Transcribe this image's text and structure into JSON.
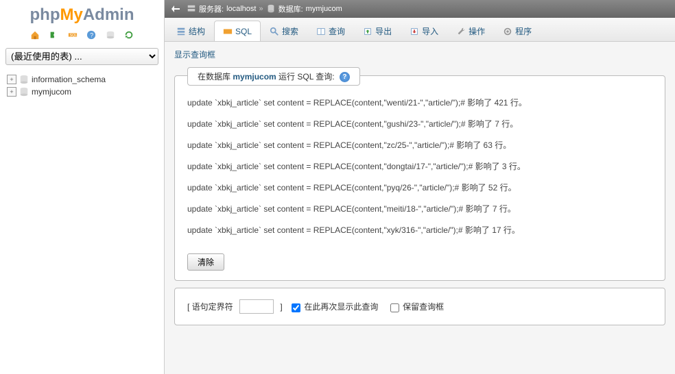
{
  "logo": {
    "part1": "php",
    "part2": "My",
    "part3": "Admin"
  },
  "recent_tables_label": "(最近使用的表) ...",
  "databases": [
    {
      "name": "information_schema"
    },
    {
      "name": "mymjucom"
    }
  ],
  "breadcrumb": {
    "server_label": "服务器:",
    "server_value": "localhost",
    "db_label": "数据库:",
    "db_value": "mymjucom"
  },
  "tabs": [
    {
      "id": "structure",
      "label": "结构"
    },
    {
      "id": "sql",
      "label": "SQL",
      "active": true
    },
    {
      "id": "search",
      "label": "搜索"
    },
    {
      "id": "query",
      "label": "查询"
    },
    {
      "id": "export",
      "label": "导出"
    },
    {
      "id": "import",
      "label": "导入"
    },
    {
      "id": "operations",
      "label": "操作"
    },
    {
      "id": "routines",
      "label": "程序"
    }
  ],
  "show_query_frame": "显示查询框",
  "panel_title_prefix": "在数据库 ",
  "panel_title_db": "mymjucom",
  "panel_title_suffix": " 运行 SQL 查询:",
  "sql_results": [
    "update `xbkj_article` set content = REPLACE(content,\"wenti/21-\",\"article/\");# 影响了 421 行。",
    "update `xbkj_article` set content = REPLACE(content,\"gushi/23-\",\"article/\");# 影响了 7 行。",
    "update `xbkj_article` set content = REPLACE(content,\"zc/25-\",\"article/\");# 影响了 63 行。",
    "update `xbkj_article` set content = REPLACE(content,\"dongtai/17-\",\"article/\");# 影响了 3 行。",
    "update `xbkj_article` set content = REPLACE(content,\"pyq/26-\",\"article/\");# 影响了 52 行。",
    "update `xbkj_article` set content = REPLACE(content,\"meiti/18-\",\"article/\");# 影响了 7 行。",
    "update `xbkj_article` set content = REPLACE(content,\"xyk/316-\",\"article/\");# 影响了 17 行。"
  ],
  "clear_label": "清除",
  "delimiter": {
    "label_open": "[ 语句定界符",
    "label_close": "]",
    "show_again_label": "在此再次显示此查询",
    "show_again_checked": true,
    "keep_frame_label": "保留查询框",
    "keep_frame_checked": false
  }
}
